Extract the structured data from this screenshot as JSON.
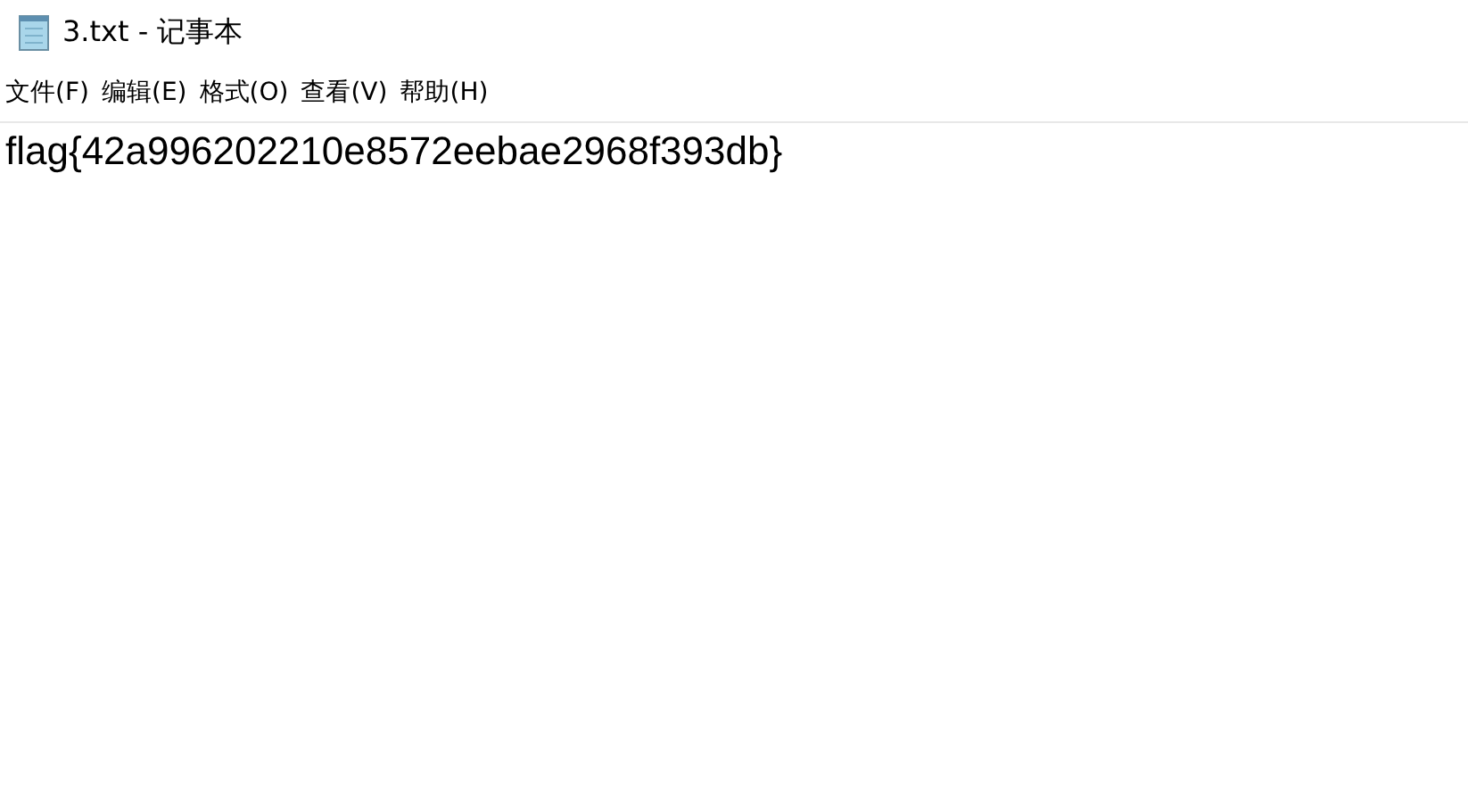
{
  "window": {
    "title": "3.txt - 记事本"
  },
  "menu": [
    "文件(F)",
    "编辑(E)",
    "格式(O)",
    "查看(V)",
    "帮助(H)"
  ],
  "editor": {
    "text": "flag{42a996202210e8572eebae2968f393db}"
  }
}
